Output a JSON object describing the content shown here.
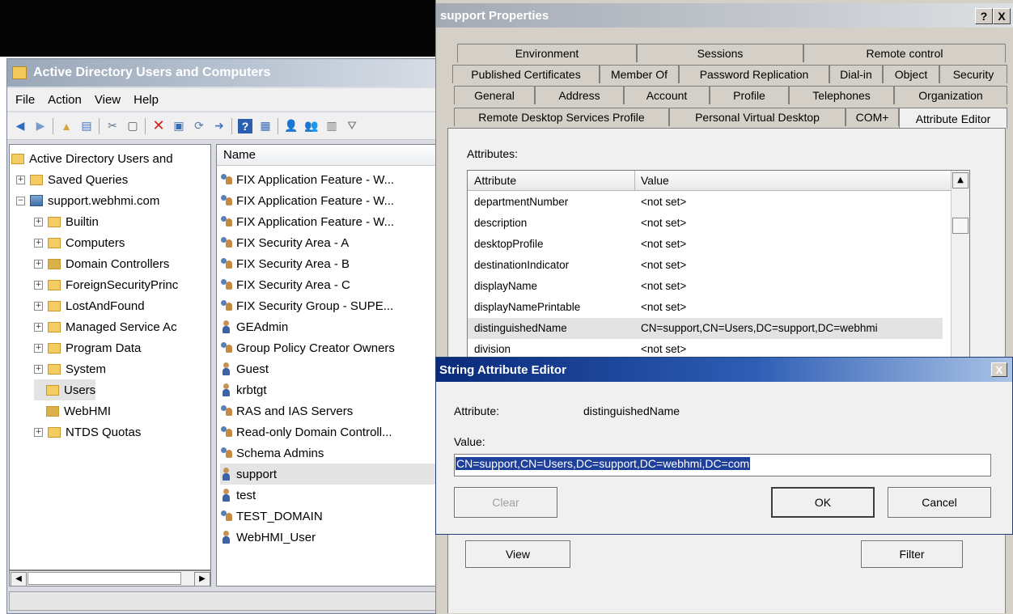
{
  "aduc": {
    "title": "Active Directory Users and Computers",
    "menu": [
      "File",
      "Action",
      "View",
      "Help"
    ],
    "tree": [
      {
        "label": "Active Directory Users and",
        "level": 0,
        "expander": "",
        "icon": "aduc-root-icon"
      },
      {
        "label": "Saved Queries",
        "level": 1,
        "expander": "+",
        "icon": "folder-icon"
      },
      {
        "label": "support.webhmi.com",
        "level": 1,
        "expander": "−",
        "icon": "domain-icon"
      },
      {
        "label": "Builtin",
        "level": 2,
        "expander": "+",
        "icon": "folder-icon"
      },
      {
        "label": "Computers",
        "level": 2,
        "expander": "+",
        "icon": "folder-icon"
      },
      {
        "label": "Domain Controllers",
        "level": 2,
        "expander": "+",
        "icon": "ou-icon"
      },
      {
        "label": "ForeignSecurityPrinc",
        "level": 2,
        "expander": "+",
        "icon": "folder-icon"
      },
      {
        "label": "LostAndFound",
        "level": 2,
        "expander": "+",
        "icon": "folder-icon"
      },
      {
        "label": "Managed Service Ac",
        "level": 2,
        "expander": "+",
        "icon": "folder-icon"
      },
      {
        "label": "Program Data",
        "level": 2,
        "expander": "+",
        "icon": "folder-icon"
      },
      {
        "label": "System",
        "level": 2,
        "expander": "+",
        "icon": "folder-icon"
      },
      {
        "label": "Users",
        "level": 2,
        "expander": "",
        "icon": "folder-icon"
      },
      {
        "label": "WebHMI",
        "level": 2,
        "expander": "",
        "icon": "ou-icon"
      },
      {
        "label": "NTDS Quotas",
        "level": 2,
        "expander": "+",
        "icon": "folder-icon"
      }
    ],
    "list_header": "Name",
    "list": [
      {
        "name": "FIX Application Feature - W...",
        "type": "group"
      },
      {
        "name": "FIX Application Feature - W...",
        "type": "group"
      },
      {
        "name": "FIX Application Feature - W...",
        "type": "group"
      },
      {
        "name": "FIX Security Area - A",
        "type": "group"
      },
      {
        "name": "FIX Security Area - B",
        "type": "group"
      },
      {
        "name": "FIX Security Area - C",
        "type": "group"
      },
      {
        "name": "FIX Security Group - SUPE...",
        "type": "group"
      },
      {
        "name": "GEAdmin",
        "type": "user"
      },
      {
        "name": "Group Policy Creator Owners",
        "type": "group"
      },
      {
        "name": "Guest",
        "type": "user"
      },
      {
        "name": "krbtgt",
        "type": "user"
      },
      {
        "name": "RAS and IAS Servers",
        "type": "group"
      },
      {
        "name": "Read-only Domain Controll...",
        "type": "group"
      },
      {
        "name": "Schema Admins",
        "type": "group"
      },
      {
        "name": "support",
        "type": "user"
      },
      {
        "name": "test",
        "type": "user"
      },
      {
        "name": "TEST_DOMAIN",
        "type": "group"
      },
      {
        "name": "WebHMI_User",
        "type": "user"
      }
    ]
  },
  "props": {
    "title": "support Properties",
    "help_btn": "?",
    "close_btn": "X",
    "tabs_row1": [
      "Environment",
      "Sessions",
      "Remote control"
    ],
    "tabs_row2": [
      "Published Certificates",
      "Member Of",
      "Password Replication",
      "Dial-in",
      "Object",
      "Security"
    ],
    "tabs_row3": [
      "General",
      "Address",
      "Account",
      "Profile",
      "Telephones",
      "Organization"
    ],
    "tabs_row4": [
      "Remote Desktop Services Profile",
      "Personal Virtual Desktop",
      "COM+",
      "Attribute Editor"
    ],
    "attributes_label": "Attributes:",
    "col_attribute": "Attribute",
    "col_value": "Value",
    "attributes": [
      {
        "name": "departmentNumber",
        "value": "<not set>"
      },
      {
        "name": "description",
        "value": "<not set>"
      },
      {
        "name": "desktopProfile",
        "value": "<not set>"
      },
      {
        "name": "destinationIndicator",
        "value": "<not set>"
      },
      {
        "name": "displayName",
        "value": "<not set>"
      },
      {
        "name": "displayNamePrintable",
        "value": "<not set>"
      },
      {
        "name": "distinguishedName",
        "value": "CN=support,CN=Users,DC=support,DC=webhmi"
      },
      {
        "name": "division",
        "value": "<not set>"
      }
    ],
    "view_btn": "View",
    "filter_btn": "Filter"
  },
  "sae": {
    "title": "String Attribute Editor",
    "close_btn": "X",
    "attribute_label": "Attribute:",
    "attribute_value": "distinguishedName",
    "value_label": "Value:",
    "value": "CN=support,CN=Users,DC=support,DC=webhmi,DC=com",
    "clear_btn": "Clear",
    "ok_btn": "OK",
    "cancel_btn": "Cancel"
  }
}
